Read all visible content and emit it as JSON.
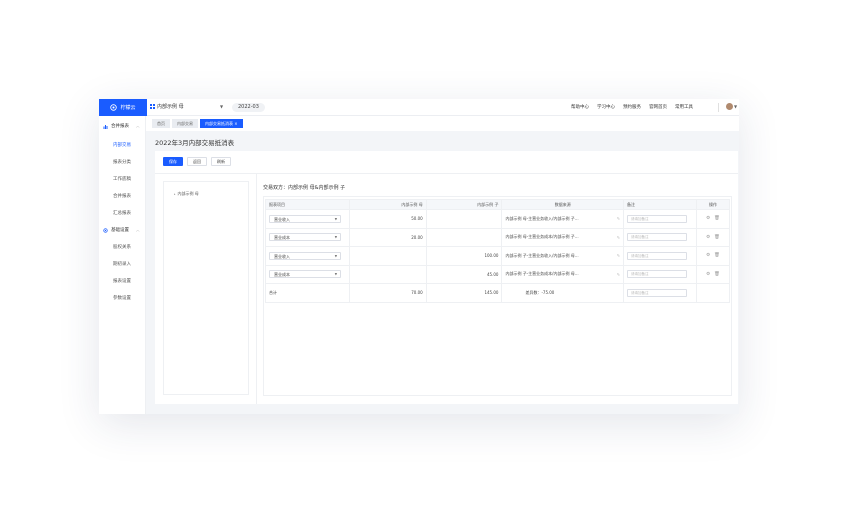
{
  "app": {
    "logo_text": "柠檬云",
    "company": "内部示例 母",
    "period": "2022-03",
    "top_links": [
      "帮助中心",
      "学习中心",
      "预约服务",
      "官网首页",
      "常用工具"
    ]
  },
  "sidebar": {
    "group1": "合并报表",
    "group1_items": [
      "内部交易",
      "报表分类",
      "工作底稿",
      "合并报表",
      "汇总报表"
    ],
    "group2": "基础设置",
    "group2_items": [
      "股权关系",
      "期初录入",
      "报表设置",
      "参数设置"
    ]
  },
  "tabs": [
    "首页",
    "内部交易",
    "内部交易抵消表"
  ],
  "page_title": "2022年3月内部交易抵消表",
  "buttons": {
    "save": "保存",
    "back": "返回",
    "refresh": "刷新"
  },
  "tree": {
    "node": "内部示例 母"
  },
  "parties_text": "交易双方：内部示例 母&内部示例 子",
  "table": {
    "headers": [
      "报表项目",
      "内部示例 母",
      "内部示例 子",
      "数据来源",
      "备注",
      "操作"
    ],
    "remark_placeholder": "请填加备注",
    "rows": [
      {
        "item": "营业收入",
        "mother": "50.00",
        "child": "",
        "source": "内部示例 母-主营业务收入/内部示例 子..."
      },
      {
        "item": "营业成本",
        "mother": "20.00",
        "child": "",
        "source": "内部示例 母-主营业务成本/内部示例 子..."
      },
      {
        "item": "营业收入",
        "mother": "",
        "child": "100.00",
        "source": "内部示例 子-主营业务收入/内部示例 母..."
      },
      {
        "item": "营业成本",
        "mother": "",
        "child": "45.00",
        "source": "内部示例 子-主营业务成本/内部示例 母..."
      }
    ],
    "total": {
      "label": "合计",
      "mother": "70.00",
      "child": "145.00",
      "diff": "差异数：-75.00"
    }
  },
  "colors": {
    "accent": "#1a5cff"
  }
}
